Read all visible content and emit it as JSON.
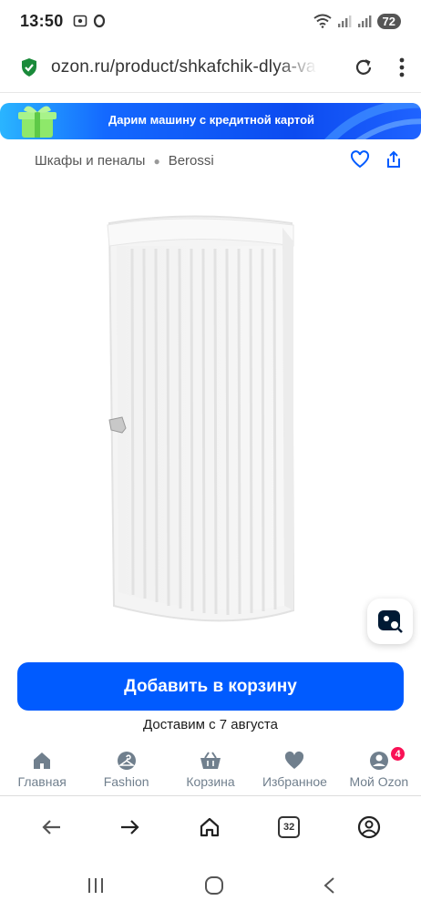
{
  "status_bar": {
    "time": "13:50",
    "battery": "72"
  },
  "browser": {
    "url": "ozon.ru/product/shkafchik-dlya-vannoy-komnaty",
    "tab_count": "32"
  },
  "promo": {
    "text": "Дарим машину с кредитной картой"
  },
  "breadcrumb": {
    "items": [
      "Шкафы и пеналы",
      "Berossi"
    ]
  },
  "product": {
    "image_icon": "cabinet-image"
  },
  "cart": {
    "button_label": "Добавить в корзину",
    "delivery_text": "Доставим с 7 августа"
  },
  "app_nav": {
    "items": [
      {
        "label": "Главная",
        "icon": "home-icon"
      },
      {
        "label": "Fashion",
        "icon": "hanger-icon"
      },
      {
        "label": "Корзина",
        "icon": "basket-icon"
      },
      {
        "label": "Избранное",
        "icon": "heart-icon"
      },
      {
        "label": "Мой Ozon",
        "icon": "profile-icon",
        "badge": "4"
      }
    ]
  },
  "colors": {
    "accent": "#005bff",
    "badge": "#f91155",
    "nav_icon": "#707f8d"
  }
}
